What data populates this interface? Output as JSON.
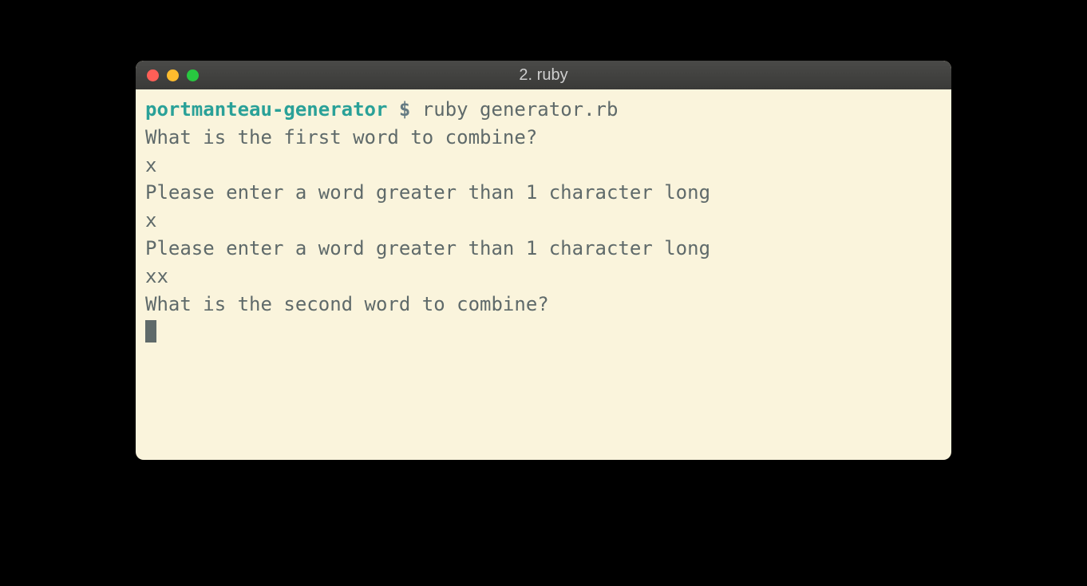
{
  "window": {
    "title": "2. ruby"
  },
  "prompt": {
    "directory": "portmanteau-generator",
    "symbol": " $ ",
    "command": "ruby generator.rb"
  },
  "lines": {
    "l1": "What is the first word to combine?",
    "l2": "x",
    "l3": "Please enter a word greater than 1 character long",
    "l4": "x",
    "l5": "Please enter a word greater than 1 character long",
    "l6": "xx",
    "l7": "What is the second word to combine?"
  }
}
